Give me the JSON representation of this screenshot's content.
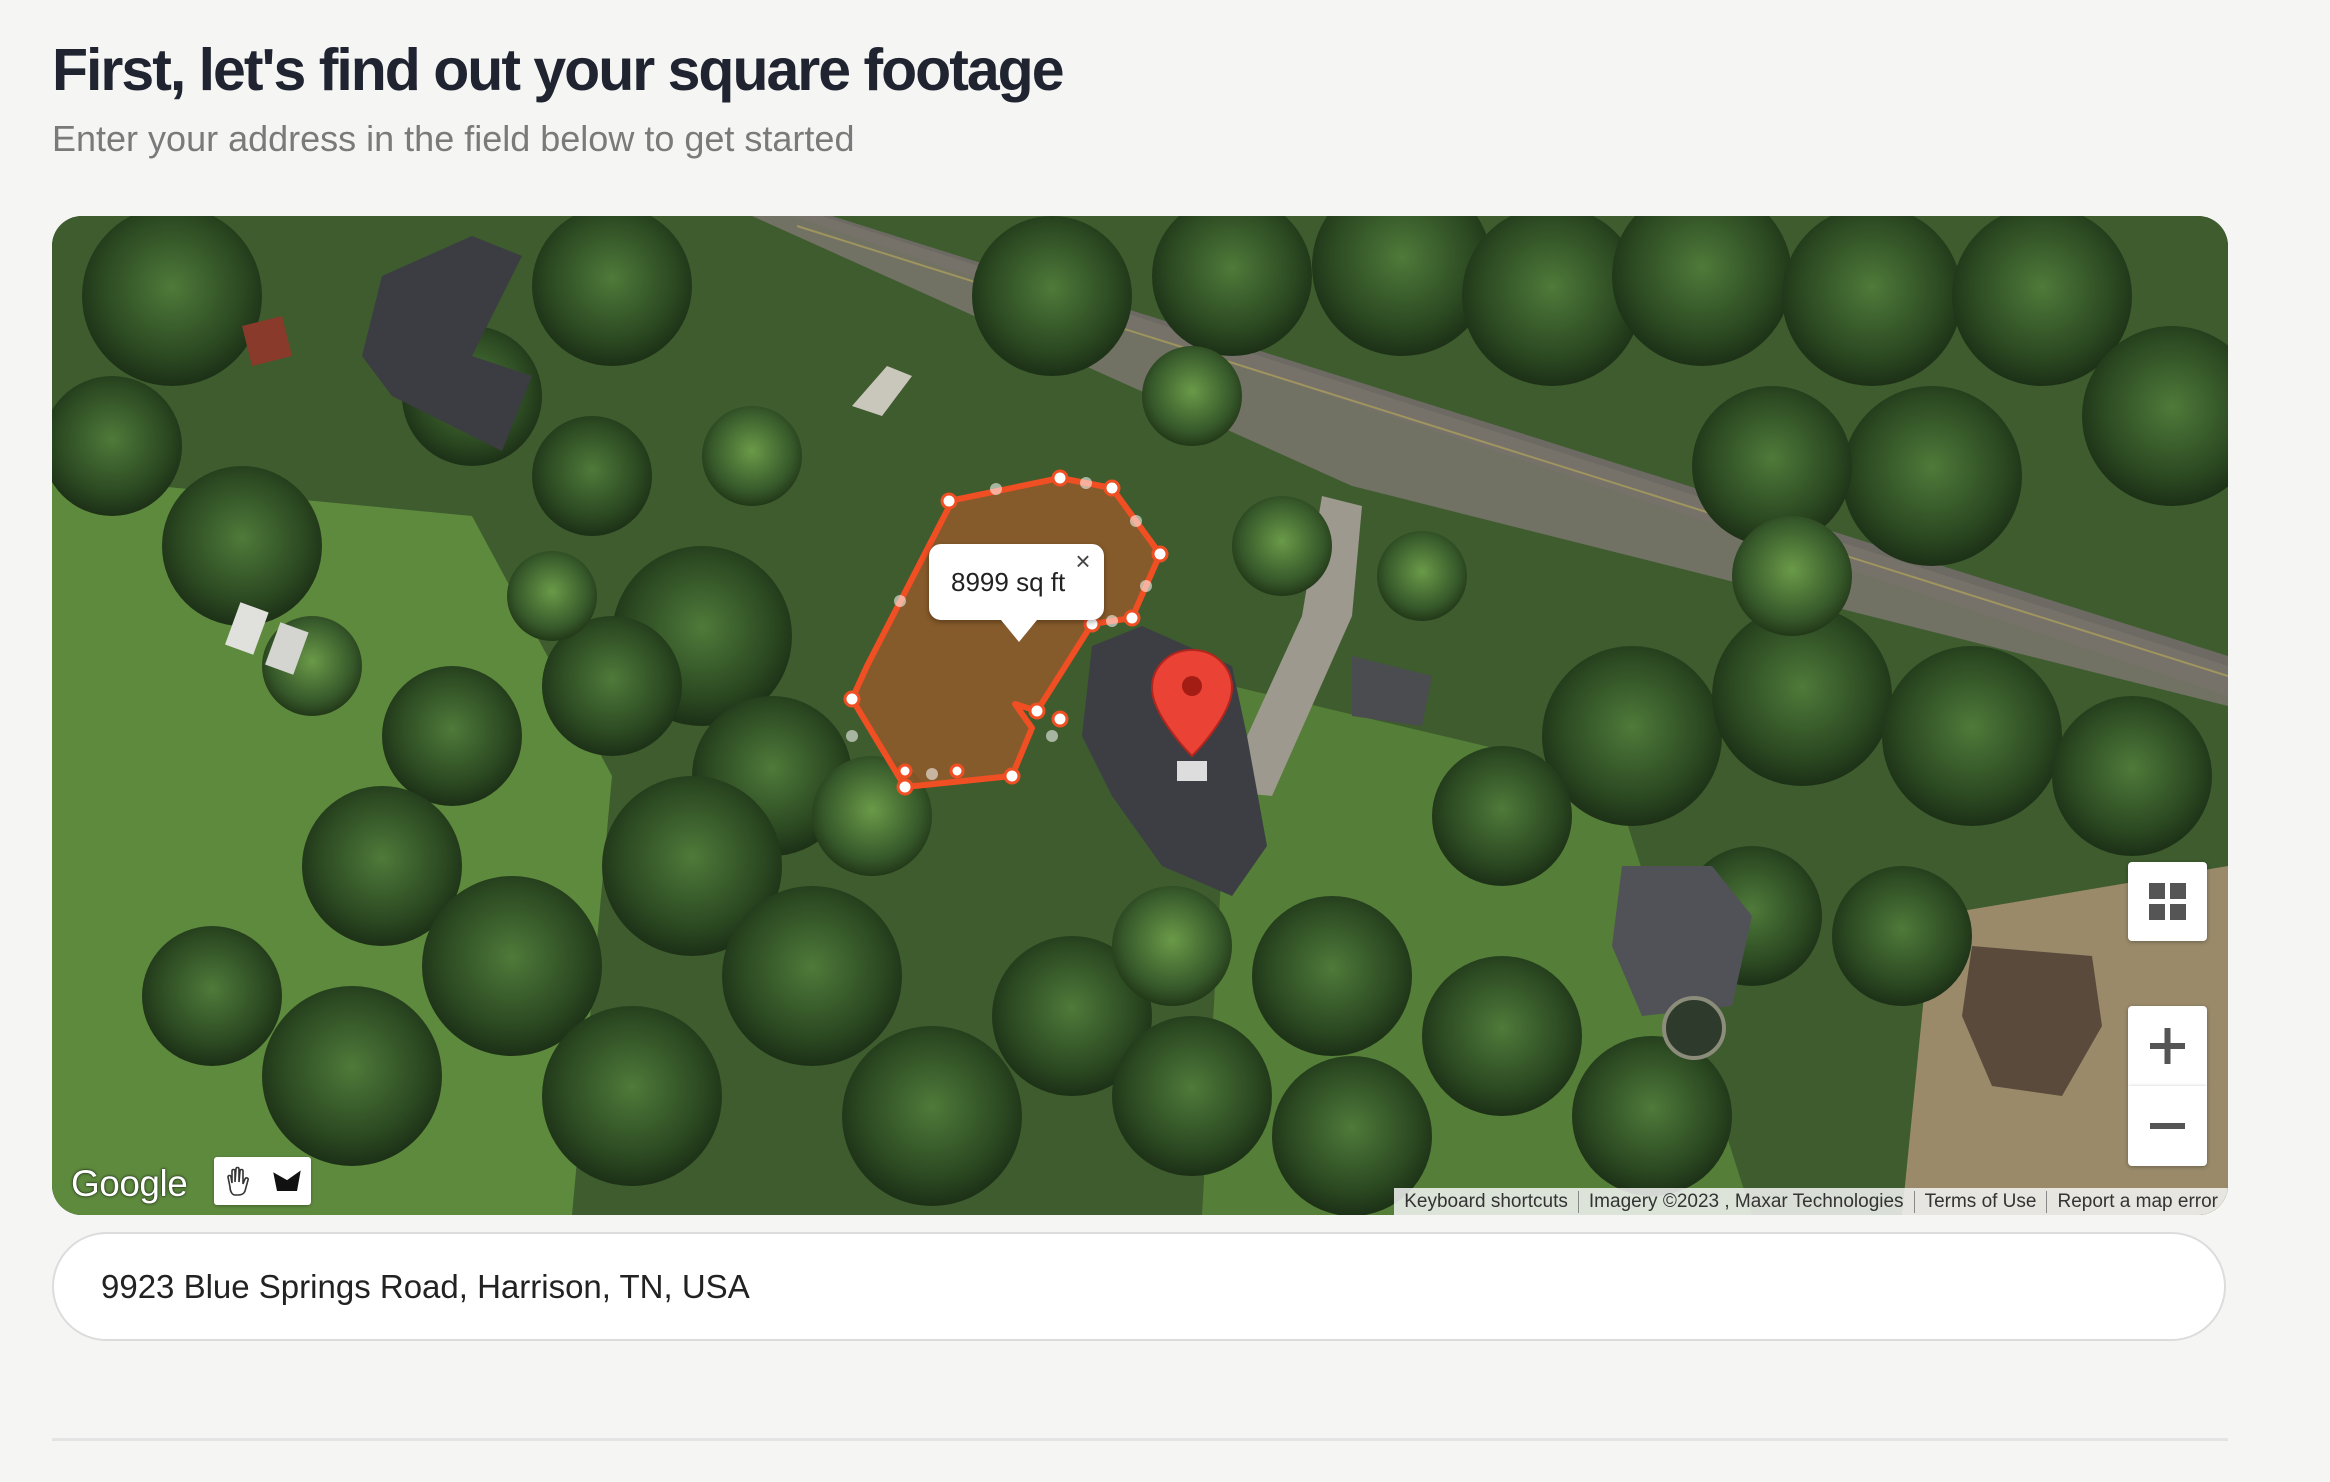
{
  "header": {
    "title": "First, let's find out your square footage",
    "subtitle": "Enter your address in the field below to get started"
  },
  "map": {
    "measurement_label": "8999 sq ft",
    "close_icon": "close-icon",
    "google_logo": "Google",
    "attribution": {
      "keyboard_shortcuts": "Keyboard shortcuts",
      "imagery": "Imagery ©2023 , Maxar Technologies",
      "terms": "Terms of Use",
      "report": "Report a map error"
    },
    "icons": {
      "layers": "grid-icon",
      "zoom_in": "plus-icon",
      "zoom_out": "minus-icon",
      "hand": "hand-icon",
      "shape": "draw-shape-icon",
      "marker": "location-pin-icon"
    },
    "polygon_color": "#f04e23",
    "marker_color": "#ea4335"
  },
  "address_input": {
    "value": "9923 Blue Springs Road, Harrison, TN, USA"
  }
}
